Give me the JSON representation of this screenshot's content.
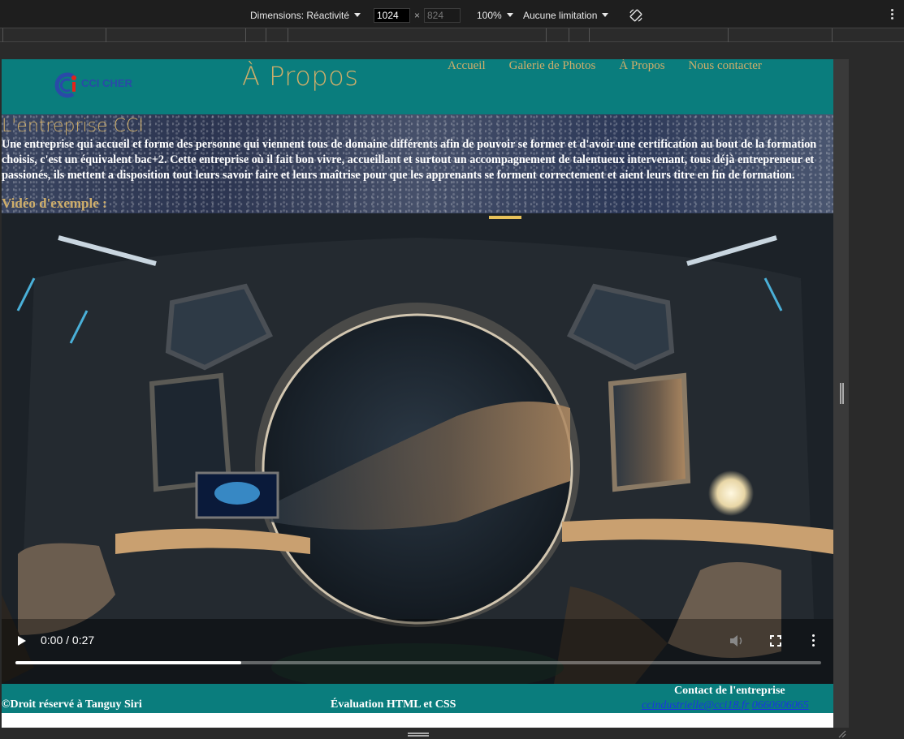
{
  "devtools": {
    "dimensions_label": "Dimensions: Réactivité",
    "width_value": "1024",
    "height_value": "824",
    "times": "×",
    "zoom": "100%",
    "throttle": "Aucune limitation"
  },
  "header": {
    "logo_text": "CCI CHER",
    "title": "À Propos",
    "nav": [
      "Accueil",
      "Galerie de Photos",
      "À Propos",
      "Nous contacter"
    ]
  },
  "intro": {
    "heading": "L'entreprise CCI",
    "text": "Une entreprise qui accueil et forme des personne qui viennent tous de domaine différents afin de pouvoir se former et d'avoir une certification au bout de la formation choisis, c'est un équivalent bac+2. Cette entreprise où il fait bon vivre, accueillant et surtout un accompagnement de talentueux intervenant, tous déjà entrepreneur et passionés, ils mettent a disposition tout leurs savoir faire et leurs maîtrise pour que les apprenants se forment correctement et aient leurs titre en fin de formation.",
    "video_heading": "Vidéo d'exemple :"
  },
  "video": {
    "time": "0:00 / 0:27",
    "progress_fraction": 0.28
  },
  "footer": {
    "copyright": "©Droit réservé à Tanguy Siri",
    "evaluation": "Évaluation HTML et CSS",
    "contact_title": "Contact de l'entreprise",
    "email": "ccindustrielle@cci18.fr",
    "phone": "0660606065"
  },
  "colors": {
    "teal": "#0a7d7d",
    "gold": "#cfae6a",
    "link_blue": "#1a35e0"
  }
}
